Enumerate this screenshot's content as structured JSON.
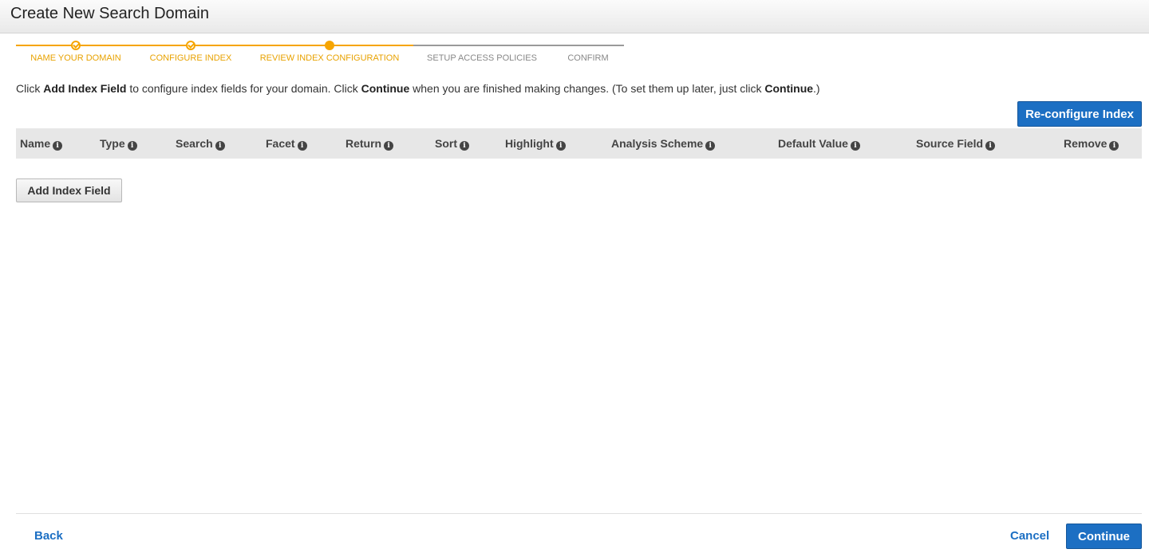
{
  "header": {
    "title": "Create New Search Domain"
  },
  "wizard": {
    "steps": [
      {
        "label": "NAME YOUR DOMAIN",
        "state": "complete"
      },
      {
        "label": "CONFIGURE INDEX",
        "state": "complete"
      },
      {
        "label": "REVIEW INDEX CONFIGURATION",
        "state": "current"
      },
      {
        "label": "SETUP ACCESS POLICIES",
        "state": "pending"
      },
      {
        "label": "CONFIRM",
        "state": "pending"
      }
    ],
    "active_color": "#f6a500",
    "inactive_color": "#9a9a9a"
  },
  "instructions": {
    "part1": "Click ",
    "bold1": "Add Index Field",
    "part2": " to configure index fields for your domain. Click ",
    "bold2": "Continue",
    "part3": " when you are finished making changes. (To set them up later, just click ",
    "bold3": "Continue",
    "part4": ".)"
  },
  "actions": {
    "reconfigure_label": "Re-configure Index",
    "add_field_label": "Add Index Field"
  },
  "table": {
    "columns": [
      "Name",
      "Type",
      "Search",
      "Facet",
      "Return",
      "Sort",
      "Highlight",
      "Analysis Scheme",
      "Default Value",
      "Source Field",
      "Remove"
    ],
    "info_icon": "info-icon",
    "rows": []
  },
  "footer": {
    "back_label": "Back",
    "cancel_label": "Cancel",
    "continue_label": "Continue"
  },
  "colors": {
    "primary": "#1c6fc3",
    "header_bg": "#e7e7e7"
  }
}
